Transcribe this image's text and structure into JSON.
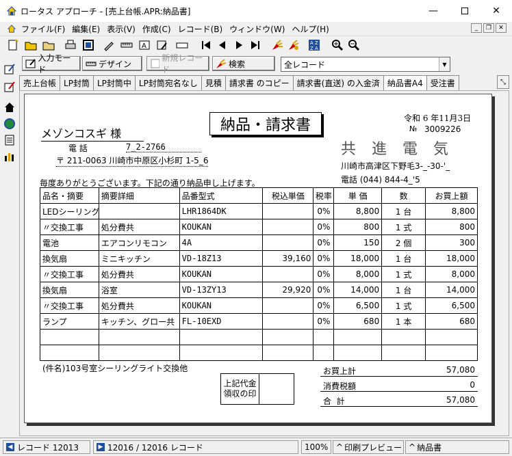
{
  "window": {
    "title": "ロータス アプローチ - [売上台帳.APR:納品書]"
  },
  "menu": [
    "ファイル(F)",
    "編集(E)",
    "表示(V)",
    "作成(C)",
    "レコード(B)",
    "ウィンドウ(W)",
    "ヘルプ(H)"
  ],
  "actions": {
    "browse_label": "入力モード",
    "design_label": "デザイン",
    "new_record_label": "新規レコード",
    "find_label": "検索",
    "record_filter": "全レコード"
  },
  "tabs": [
    "売上台帳",
    "LP封筒",
    "LP封筒中",
    "LP封筒宛名なし",
    "見積",
    "請求書 のコピー",
    "請求書(直送) の入金済",
    "納品書A4",
    "受注書"
  ],
  "doc": {
    "title": "納品・請求書",
    "date": "令和 6 年11月3日",
    "no_label": "№",
    "no": "3009226",
    "customer": "メゾンコスギ 様",
    "phone_label": "電 話",
    "phone": "7_2-2766",
    "address": "〒 211-0063 川崎市中原区小杉町 1-5_6",
    "company": "共 進 電 気",
    "company_address": "川崎市高津区下野毛3-_-30-'_",
    "company_phone": "電話 (044) 844-4_'5",
    "greeting": "毎度ありがとうございます。下記の通り納品申し上げます。",
    "headers": [
      "品名・摘要",
      "摘要詳細",
      "品番型式",
      "税込単価",
      "税率",
      "単 価",
      "数",
      "お買上額"
    ],
    "rows": [
      [
        "LEDシーリングライトリビング",
        "",
        "LHR1864DK",
        "",
        "0%",
        "8,800",
        "1 台",
        "8,800"
      ],
      [
        "〃交換工事",
        "処分費共",
        "KOUKAN",
        "",
        "0%",
        "800",
        "1 式",
        "800"
      ],
      [
        "電池",
        "エアコンリモコン",
        "4A",
        "",
        "0%",
        "150",
        "2 個",
        "300"
      ],
      [
        "換気扇",
        "ミニキッチン",
        "VD-18Z13",
        "39,160",
        "0%",
        "18,000",
        "1 台",
        "18,000"
      ],
      [
        "〃交換工事",
        "処分費共",
        "KOUKAN",
        "",
        "0%",
        "8,000",
        "1 式",
        "8,000"
      ],
      [
        "換気扇",
        "浴室",
        "VD-13ZY13",
        "29,920",
        "0%",
        "14,000",
        "1 台",
        "14,000"
      ],
      [
        "〃交換工事",
        "処分費共",
        "KOUKAN",
        "",
        "0%",
        "6,500",
        "1 式",
        "6,500"
      ],
      [
        "ランプ",
        "キッチン、グロー共",
        "FL-10EXD",
        "",
        "0%",
        "680",
        "1 本",
        "680"
      ],
      [
        "",
        "",
        "",
        "",
        "",
        "",
        "",
        ""
      ],
      [
        "",
        "",
        "",
        "",
        "",
        "",
        "",
        ""
      ]
    ],
    "subject": "(件名)103号室シーリングライト交換他",
    "stamp_label": "上記代金\n領収の印",
    "subtotal_label": "お買上計",
    "subtotal": "57,080",
    "tax_label": "消費税額",
    "tax": "0",
    "total_label": "合  計",
    "total": "57,080"
  },
  "status": {
    "record_label": "レコード 12013",
    "record_count": "12016 / 12016 レコード",
    "zoom": "100%",
    "mode": "印刷プレビュー",
    "form": "納品書"
  }
}
